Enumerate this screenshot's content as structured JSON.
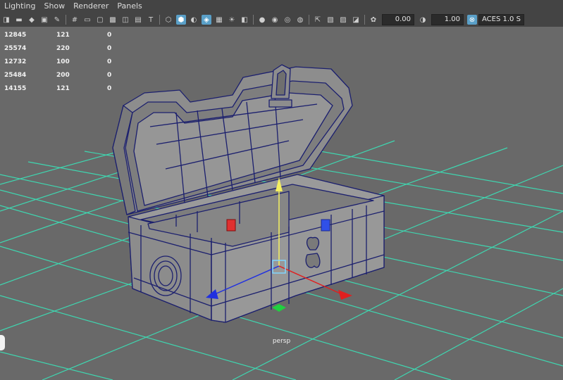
{
  "menu": [
    "Lighting",
    "Show",
    "Renderer",
    "Panels"
  ],
  "toolbar": {
    "icons": [
      "select-camera-icon",
      "camera-attributes-icon",
      "bookmark-icon",
      "image-plane-icon",
      "grease-pencil-icon",
      "grid-icon",
      "film-gate-icon",
      "resolution-gate-icon",
      "gate-mask-icon",
      "field-chart-icon",
      "safe-action-icon",
      "safe-title-icon",
      "wireframe-icon",
      "smooth-shade-icon",
      "default-material-icon",
      "wireframe-on-shaded-icon",
      "textured-icon",
      "lights-icon",
      "shadows-icon",
      "screen-space-ao-icon",
      "motion-blur-icon",
      "anti-aliasing-icon",
      "depth-of-field-icon",
      "isolate-select-icon",
      "xray-icon",
      "xray-active-icon",
      "xray-joints-icon",
      "exposure-icon",
      "gamma-icon",
      "color-management-icon"
    ],
    "exposure_value": "0.00",
    "gamma_value": "1.00",
    "color_space": "ACES 1.0 S"
  },
  "hud": {
    "rows": [
      [
        "12845",
        "121",
        "0"
      ],
      [
        "25574",
        "220",
        "0"
      ],
      [
        "12732",
        "100",
        "0"
      ],
      [
        "25484",
        "200",
        "0"
      ],
      [
        "14155",
        "121",
        "0"
      ]
    ]
  },
  "camera_label": "persp",
  "colors": {
    "viewport_bg": "#696969",
    "grid": "#3fd6b0",
    "wire": "#1b1f6e",
    "mesh": "#8a8a8a",
    "axis_x": "#e02020",
    "axis_y": "#f5f060",
    "axis_z": "#2030e0",
    "pivot": "#20d040"
  }
}
